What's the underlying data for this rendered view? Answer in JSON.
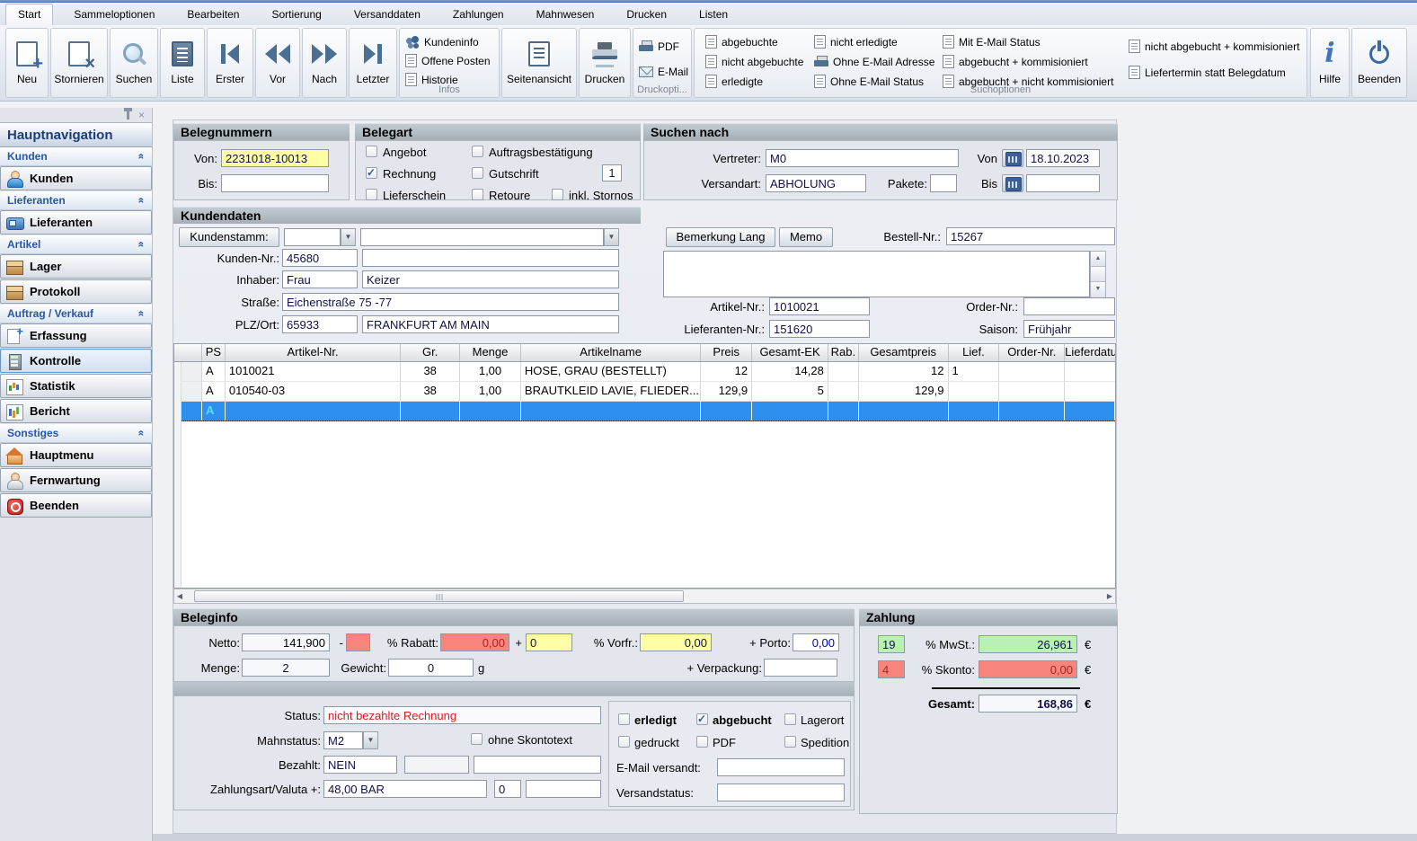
{
  "colors": {
    "selection_blue": "#2f8fee",
    "field_yellow": "#fdfda6",
    "field_red": "#f8857c",
    "field_green": "#b9f2b5",
    "status_red_text": "#d02020"
  },
  "window": {
    "tabs": [
      "Start",
      "Sammeloptionen",
      "Bearbeiten",
      "Sortierung",
      "Versanddaten",
      "Zahlungen",
      "Mahnwesen",
      "Drucken",
      "Listen"
    ],
    "active_tab": "Start"
  },
  "ribbon": {
    "nav": [
      "Neu",
      "Stornieren",
      "Suchen",
      "Liste",
      "Erster",
      "Vor",
      "Nach",
      "Letzter"
    ],
    "infos": {
      "caption": "Infos",
      "items": [
        "Kundeninfo",
        "Offene Posten",
        "Historie"
      ]
    },
    "seitenansicht": "Seitenansicht",
    "drucken": "Drucken",
    "druck": {
      "caption": "Druckopti...",
      "pdf": "PDF",
      "email": "E-Mail"
    },
    "such": {
      "caption": "Suchoptionen",
      "col1": [
        "abgebuchte",
        "nicht abgebuchte",
        "erledigte"
      ],
      "col2": [
        "nicht erledigte",
        "Ohne E-Mail Adresse",
        "Ohne E-Mail Status"
      ],
      "col3": [
        "Mit E-Mail Status",
        "abgebucht + kommisioniert",
        "abgebucht + nicht kommisioniert"
      ],
      "col4": [
        "nicht abgebucht + kommisioniert",
        "Liefertermin statt Belegdatum"
      ]
    },
    "hilfe": "Hilfe",
    "beenden": "Beenden"
  },
  "sidebar": {
    "title": "Hauptnavigation",
    "groups": [
      {
        "header": "Kunden",
        "items": [
          {
            "label": "Kunden",
            "selected": false
          }
        ]
      },
      {
        "header": "Lieferanten",
        "items": [
          {
            "label": "Lieferanten",
            "selected": false
          }
        ]
      },
      {
        "header": "Artikel",
        "items": [
          {
            "label": "Lager",
            "selected": false
          },
          {
            "label": "Protokoll",
            "selected": false
          }
        ]
      },
      {
        "header": "Auftrag / Verkauf",
        "items": [
          {
            "label": "Erfassung",
            "selected": false
          },
          {
            "label": "Kontrolle",
            "selected": true
          },
          {
            "label": "Statistik",
            "selected": false
          },
          {
            "label": "Bericht",
            "selected": false
          }
        ]
      },
      {
        "header": "Sonstiges",
        "items": [
          {
            "label": "Hauptmenu",
            "selected": false
          },
          {
            "label": "Fernwartung",
            "selected": false
          },
          {
            "label": "Beenden",
            "selected": false
          }
        ]
      }
    ]
  },
  "belegnummern": {
    "title": "Belegnummern",
    "von_label": "Von:",
    "von": "2231018-10013",
    "bis_label": "Bis:",
    "bis": ""
  },
  "belegart": {
    "title": "Belegart",
    "opt1": {
      "label": "Angebot",
      "checked": false
    },
    "opt2": {
      "label": "Rechnung",
      "checked": true
    },
    "opt3": {
      "label": "Lieferschein",
      "checked": false
    },
    "opt4": {
      "label": "Auftragsbestätigung",
      "checked": false
    },
    "opt5": {
      "label": "Gutschrift",
      "checked": false,
      "count": "1"
    },
    "opt6": {
      "label": "Retoure",
      "checked": false
    },
    "opt7": {
      "label": "inkl. Stornos",
      "checked": false
    }
  },
  "suche": {
    "title": "Suchen nach",
    "vertreter_label": "Vertreter:",
    "vertreter": "M0",
    "versandart_label": "Versandart:",
    "versandart": "ABHOLUNG",
    "pakete_label": "Pakete:",
    "pakete": "",
    "von_label": "Von",
    "von_datum": "18.10.2023",
    "bis_label": "Bis",
    "bis_datum": ""
  },
  "kundendaten": {
    "title": "Kundendaten",
    "kundenstamm_button": "Kundenstamm:",
    "kunden_nr_label": "Kunden-Nr.:",
    "kunden_nr": "45680",
    "kunden_name": "",
    "inhaber_label": "Inhaber:",
    "anrede": "Frau",
    "nachname": "Keizer",
    "strasse_label": "Straße:",
    "strasse": "Eichenstraße 75 -77",
    "plz_label": "PLZ/Ort:",
    "plz": "65933",
    "ort": "FRANKFURT AM MAIN"
  },
  "bemerkung": {
    "lang_button": "Bemerkung Lang",
    "memo_button": "Memo",
    "bestell_label": "Bestell-Nr.:",
    "bestell_nr": "15267",
    "text": "",
    "artikel_label": "Artikel-Nr.:",
    "artikel_nr": "1010021",
    "order_label": "Order-Nr.:",
    "order_nr": "",
    "lieferanten_label": "Lieferanten-Nr.:",
    "lieferanten_nr": "151620",
    "saison_label": "Saison:",
    "saison": "Frühjahr"
  },
  "table": {
    "columns": [
      "PS",
      "Artikel-Nr.",
      "Gr.",
      "Menge",
      "Artikelname",
      "Preis",
      "Gesamt-EK",
      "Rab.",
      "Gesamtpreis",
      "Lief.",
      "Order-Nr.",
      "Lieferdatu"
    ],
    "rows": [
      {
        "ps": "A",
        "artikel_nr": "1010021",
        "gr": "38",
        "menge": "1,00",
        "artikelname": "HOSE, GRAU (BESTELLT)",
        "preis": "12",
        "gesamt_ek": "14,28",
        "rab": "",
        "gesamtpreis": "12",
        "lief": "1",
        "order_nr": "",
        "lieferdatum": "",
        "selected": false
      },
      {
        "ps": "A",
        "artikel_nr": "010540-03",
        "gr": "38",
        "menge": "1,00",
        "artikelname": "BRAUTKLEID LAVIE, FLIEDER...",
        "preis": "129,9",
        "gesamt_ek": "5",
        "rab": "",
        "gesamtpreis": "129,9",
        "lief": "",
        "order_nr": "",
        "lieferdatum": "",
        "selected": false
      },
      {
        "ps": "A",
        "artikel_nr": "",
        "gr": "",
        "menge": "",
        "artikelname": "",
        "preis": "",
        "gesamt_ek": "",
        "rab": "",
        "gesamtpreis": "",
        "lief": "",
        "order_nr": "",
        "lieferdatum": "",
        "selected": true
      }
    ]
  },
  "beleginfo": {
    "title": "Beleginfo",
    "netto_label": "Netto:",
    "netto": "141,900",
    "minus": "-",
    "rabatt_factor": "",
    "rabatt_label": "% Rabatt:",
    "rabatt": "0,00",
    "plus": "+",
    "vorfr_factor": "0",
    "vorfr_label": "% Vorfr.:",
    "vorfr": "0,00",
    "porto_label": "+ Porto:",
    "porto": "0,00",
    "menge_label": "Menge:",
    "menge": "2",
    "gewicht_label": "Gewicht:",
    "gewicht": "0",
    "gewicht_unit": "g",
    "verpackung_label": "+ Verpackung:",
    "verpackung": ""
  },
  "zahlung": {
    "title": "Zahlung",
    "mwst_pct": "19",
    "mwst_label": "% MwSt.:",
    "mwst": "26,961",
    "skonto_pct": "4",
    "skonto_label": "% Skonto:",
    "skonto": "0,00",
    "gesamt_label": "Gesamt:",
    "gesamt": "168,86",
    "eur": "€"
  },
  "status": {
    "status_label": "Status:",
    "status": "nicht bezahlte Rechnung",
    "mahnstatus_label": "Mahnstatus:",
    "mahnstatus": "M2",
    "ohne_skontotext_label": "ohne Skontotext",
    "ohne_skontotext_checked": false,
    "bezahlt_label": "Bezahlt:",
    "bezahlt": "NEIN",
    "bezahlt2": "",
    "bezahlt3": "",
    "zahlungsart_label": "Zahlungsart/Valuta +:",
    "zahlungsart": "48,00 BAR",
    "valuta": "0",
    "zahlungsart3": "",
    "flags": {
      "erledigt": {
        "label": "erledigt",
        "checked": false
      },
      "abgebucht": {
        "label": "abgebucht",
        "checked": true
      },
      "lagerort": {
        "label": "Lagerort",
        "checked": false
      },
      "gedruckt": {
        "label": "gedruckt",
        "checked": false
      },
      "pdf": {
        "label": "PDF",
        "checked": false
      },
      "spedition": {
        "label": "Spedition",
        "checked": false
      }
    },
    "email_versandt_label": "E-Mail versandt:",
    "email_versandt": "",
    "versandstatus_label": "Versandstatus:",
    "versandstatus": ""
  }
}
